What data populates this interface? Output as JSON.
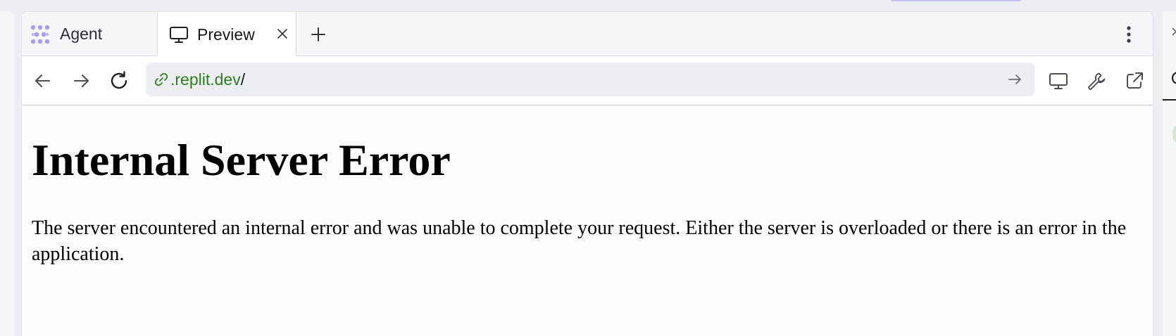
{
  "tabs": {
    "agent": {
      "label": "Agent",
      "icon": "agent-dots-icon"
    },
    "preview": {
      "label": "Preview",
      "icon": "monitor-icon",
      "close_icon": "close-icon"
    },
    "new_tab_icon": "plus-icon",
    "menu_icon": "kebab-menu-icon"
  },
  "toolbar": {
    "back_icon": "arrow-left-icon",
    "forward_icon": "arrow-right-icon",
    "reload_icon": "reload-icon",
    "url": {
      "link_icon": "link-icon",
      "domain": ".replit.dev",
      "path": "/",
      "go_icon": "arrow-right-icon"
    },
    "device_icon": "monitor-icon",
    "devtools_icon": "wrench-icon",
    "open_external_icon": "external-link-icon"
  },
  "page": {
    "heading": "Internal Server Error",
    "message": "The server encountered an internal error and was unable to complete your request. Either the server is overloaded or there is an error in the application."
  },
  "colors": {
    "agent_accent": "#a99cf0",
    "url_domain": "#2f7d1f",
    "tabbar_bg": "#f5f6f8",
    "urlbar_bg": "#eceef1"
  }
}
